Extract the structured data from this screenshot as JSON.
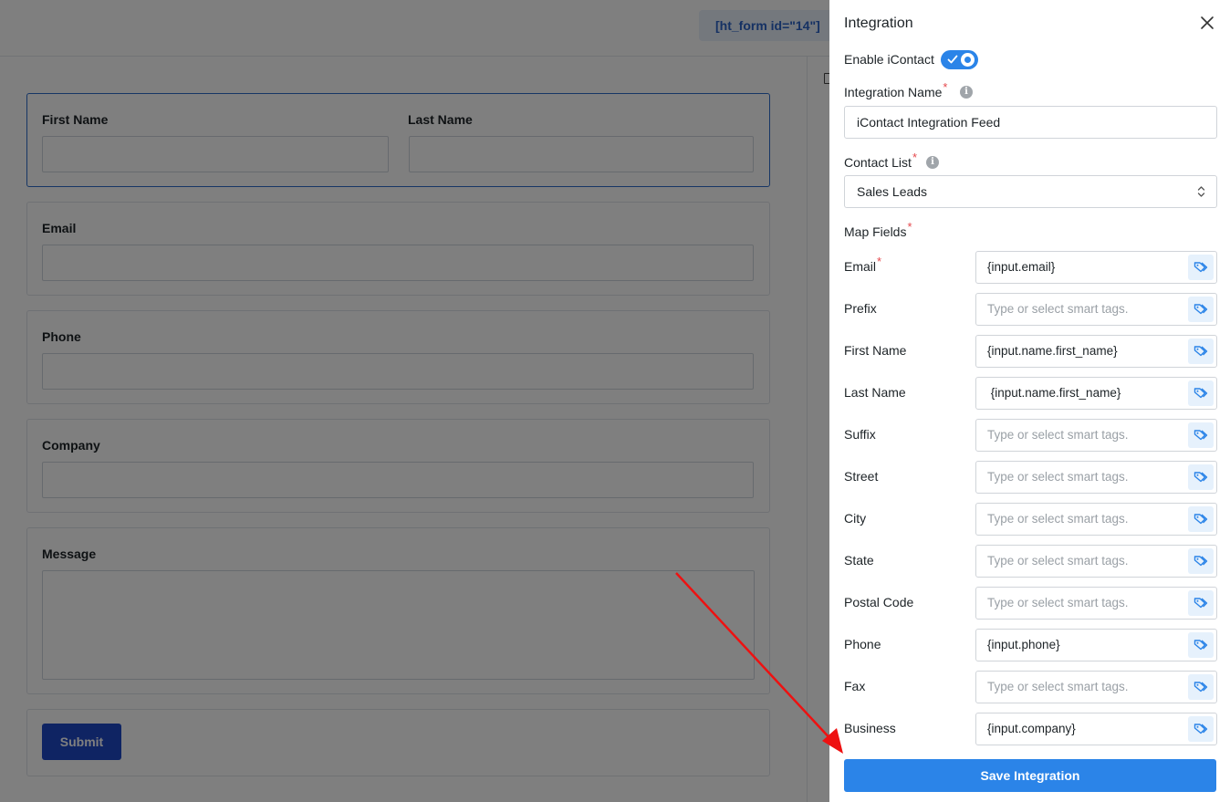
{
  "background": {
    "shortcode": "[ht_form id=\"14\"]",
    "fields": {
      "first_name_label": "First Name",
      "last_name_label": "Last Name",
      "email_label": "Email",
      "phone_label": "Phone",
      "company_label": "Company",
      "message_label": "Message",
      "submit_label": "Submit"
    }
  },
  "drawer": {
    "title": "Integration",
    "enable_label": "Enable iContact",
    "enabled": true,
    "integration_name_label": "Integration Name",
    "integration_name_value": "iContact Integration Feed",
    "contact_list_label": "Contact List",
    "contact_list_value": "Sales Leads",
    "map_fields_label": "Map Fields",
    "required_mark": "*",
    "info_glyph": "i",
    "placeholder": "Type or select smart tags.",
    "map_rows": [
      {
        "label": "Email",
        "value": "{input.email}",
        "required": true
      },
      {
        "label": "Prefix",
        "value": ""
      },
      {
        "label": "First Name",
        "value": "{input.name.first_name}"
      },
      {
        "label": "Last Name",
        "value": " {input.name.first_name}"
      },
      {
        "label": "Suffix",
        "value": ""
      },
      {
        "label": "Street",
        "value": ""
      },
      {
        "label": "City",
        "value": ""
      },
      {
        "label": "State",
        "value": ""
      },
      {
        "label": "Postal Code",
        "value": ""
      },
      {
        "label": "Phone",
        "value": "{input.phone}"
      },
      {
        "label": "Fax",
        "value": ""
      },
      {
        "label": "Business",
        "value": "{input.company}"
      }
    ],
    "save_label": "Save Integration"
  },
  "colors": {
    "accent": "#2b84e8",
    "required": "#e5484d",
    "annotation_arrow": "#ee1111"
  }
}
